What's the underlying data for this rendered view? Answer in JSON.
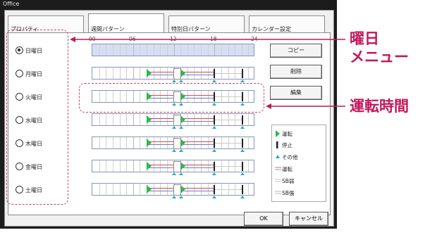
{
  "window": {
    "title": "Office"
  },
  "tabs": [
    {
      "label": "プロパティ",
      "active": false
    },
    {
      "label": "週間パターン",
      "active": true
    },
    {
      "label": "特別日パターン",
      "active": false
    },
    {
      "label": "カレンダー設定",
      "active": false
    }
  ],
  "hours": [
    "00",
    "06",
    "12",
    "18",
    "24"
  ],
  "days": [
    {
      "label": "日曜日",
      "selected": true
    },
    {
      "label": "月曜日",
      "selected": false
    },
    {
      "label": "火曜日",
      "selected": false
    },
    {
      "label": "水曜日",
      "selected": false
    },
    {
      "label": "木曜日",
      "selected": false
    },
    {
      "label": "金曜日",
      "selected": false
    },
    {
      "label": "土曜日",
      "selected": false
    }
  ],
  "buttons": {
    "copy": "コピー",
    "delete": "削除",
    "edit": "編集",
    "ok": "OK",
    "cancel": "キャンセル"
  },
  "legend": [
    {
      "label": "運転",
      "icon": "run-marker-icon"
    },
    {
      "label": "停止",
      "icon": "stop-marker-icon"
    },
    {
      "label": "その他",
      "icon": "other-marker-icon"
    },
    {
      "label": "運転",
      "icon": "run-line-icon"
    },
    {
      "label": "SB弱",
      "icon": "sb-weak-line-icon"
    },
    {
      "label": "SB強",
      "icon": "sb-strong-line-icon"
    }
  ],
  "annotations": {
    "day_menu": "曜日\nメニュー",
    "operating_time": "運転時間"
  },
  "colors": {
    "accent": "#c2185b",
    "run": "#2db84a",
    "marker": "#29a9c9",
    "selected_row": "#d6def4"
  }
}
